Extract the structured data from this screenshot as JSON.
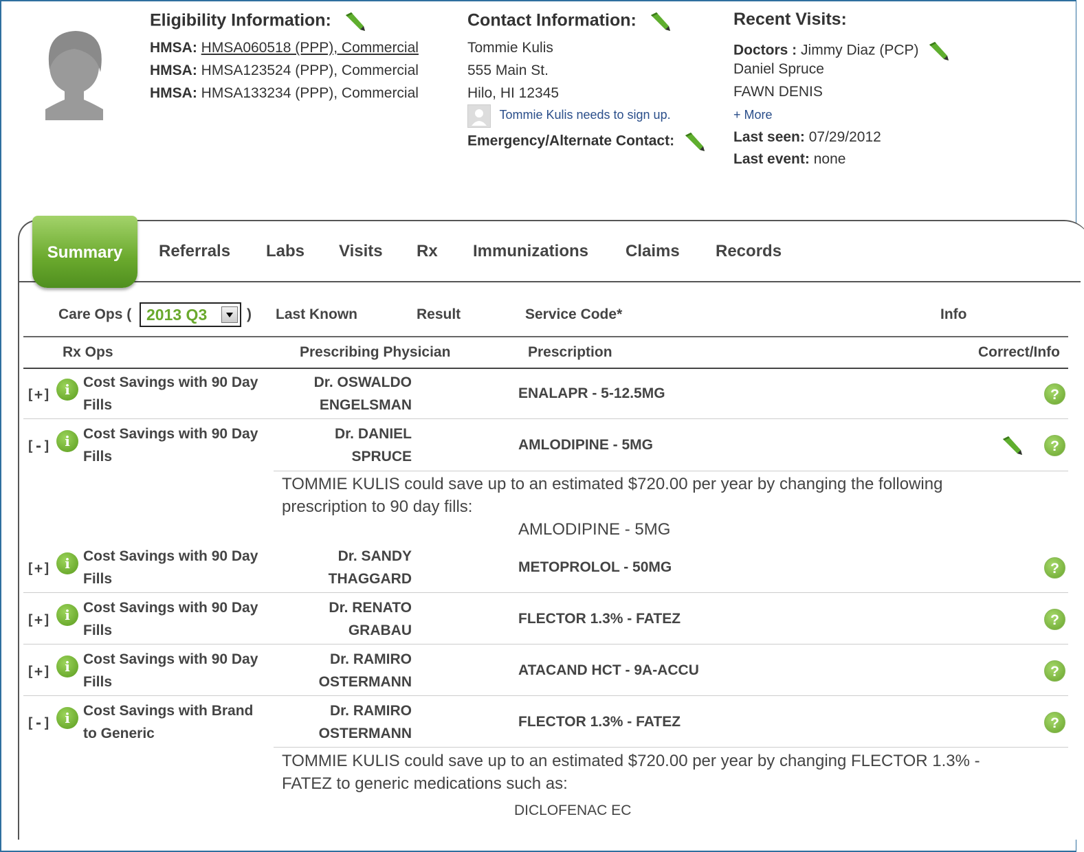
{
  "eligibility": {
    "title": "Eligibility Information:",
    "rows": [
      {
        "label": "HMSA:",
        "value": "HMSA060518 (PPP), Commercial"
      },
      {
        "label": "HMSA:",
        "value": "HMSA123524 (PPP), Commercial"
      },
      {
        "label": "HMSA:",
        "value": "HMSA133234 (PPP), Commercial"
      }
    ]
  },
  "contact": {
    "title": "Contact Information:",
    "name": "Tommie Kulis",
    "address1": "555 Main St.",
    "address2": "Hilo, HI 12345",
    "signup_text": "Tommie Kulis needs to sign up.",
    "emergency_label": "Emergency/Alternate Contact:"
  },
  "visits": {
    "title": "Recent Visits:",
    "doctors_label": "Doctors :",
    "doctors": [
      "Jimmy Diaz (PCP)",
      "Daniel Spruce",
      "FAWN DENIS"
    ],
    "more_link": "+ More",
    "last_seen_label": "Last seen:",
    "last_seen_value": "07/29/2012",
    "last_event_label": "Last event:",
    "last_event_value": "none"
  },
  "tabs": [
    "Summary",
    "Referrals",
    "Labs",
    "Visits",
    "Rx",
    "Immunizations",
    "Claims",
    "Records"
  ],
  "careops": {
    "label_open": "Care Ops (",
    "selected": "2013 Q3",
    "label_close": ")",
    "col_last_known": "Last Known",
    "col_result": "Result",
    "col_service": "Service Code*",
    "col_info": "Info"
  },
  "rx": {
    "col_ops": "Rx Ops",
    "col_physician": "Prescribing Physician",
    "col_prescription": "Prescription",
    "col_correct": "Correct/Info",
    "rows": [
      {
        "toggle": "[+]",
        "op1": "Cost Savings with 90 Day",
        "op2": "Fills",
        "phys1": "Dr. OSWALDO",
        "phys2": "ENGELSMAN",
        "rx": "ENALAPR - 5-12.5MG"
      },
      {
        "toggle": "[-]",
        "op1": "Cost Savings with 90 Day",
        "op2": "Fills",
        "phys1": "Dr. DANIEL",
        "phys2": "SPRUCE",
        "rx": "AMLODIPINE - 5MG"
      },
      {
        "toggle": "[+]",
        "op1": "Cost Savings with 90 Day",
        "op2": "Fills",
        "phys1": "Dr. SANDY",
        "phys2": "THAGGARD",
        "rx": "METOPROLOL - 50MG"
      },
      {
        "toggle": "[+]",
        "op1": "Cost Savings with 90 Day",
        "op2": "Fills",
        "phys1": "Dr. RENATO",
        "phys2": "GRABAU",
        "rx": "FLECTOR 1.3% - FATEZ"
      },
      {
        "toggle": "[+]",
        "op1": "Cost Savings with 90 Day",
        "op2": "Fills",
        "phys1": "Dr. RAMIRO",
        "phys2": "OSTERMANN",
        "rx": "ATACAND HCT - 9A-ACCU"
      },
      {
        "toggle": "[-]",
        "op1": "Cost Savings with Brand",
        "op2": "to Generic",
        "phys1": "Dr. RAMIRO",
        "phys2": "OSTERMANN",
        "rx": "FLECTOR 1.3% - FATEZ"
      }
    ],
    "detail1_line1": "TOMMIE KULIS could save up to an estimated $720.00 per year by changing the following",
    "detail1_line2": "prescription to 90 day fills:",
    "detail1_drug": "AMLODIPINE - 5MG",
    "detail2_line1": "TOMMIE KULIS could save up to an estimated $720.00 per year by changing FLECTOR 1.3% -",
    "detail2_line2": "FATEZ to generic medications such as:",
    "detail2_drug": "DICLOFENAC EC"
  }
}
